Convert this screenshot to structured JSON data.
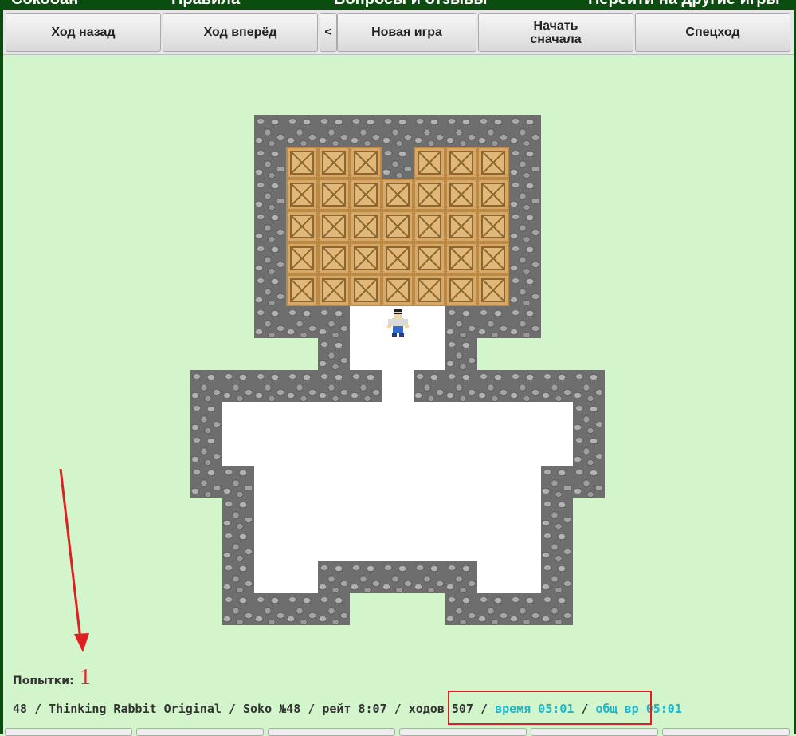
{
  "topnav": [
    "Сокобан",
    "Правила",
    "Вопросы и отзывы",
    "Перейти на другие игры"
  ],
  "toolbar": {
    "undo": "Ход назад",
    "redo": "Ход вперёд",
    "prev": "<",
    "new_game": "Новая игра",
    "restart_line1": "Начать",
    "restart_line2": "сначала",
    "special": "Спецход"
  },
  "board": {
    "walls": [
      [
        8,
        3
      ],
      [
        9,
        3
      ],
      [
        10,
        3
      ],
      [
        11,
        3
      ],
      [
        12,
        3
      ],
      [
        13,
        3
      ],
      [
        14,
        3
      ],
      [
        15,
        3
      ],
      [
        16,
        3
      ],
      [
        8,
        4
      ],
      [
        12,
        4
      ],
      [
        16,
        4
      ],
      [
        8,
        5
      ],
      [
        16,
        5
      ],
      [
        8,
        6
      ],
      [
        16,
        6
      ],
      [
        8,
        7
      ],
      [
        16,
        7
      ],
      [
        8,
        8
      ],
      [
        16,
        8
      ],
      [
        8,
        9
      ],
      [
        9,
        9
      ],
      [
        10,
        9
      ],
      [
        14,
        9
      ],
      [
        15,
        9
      ],
      [
        16,
        9
      ],
      [
        10,
        10
      ],
      [
        14,
        10
      ],
      [
        6,
        11
      ],
      [
        7,
        11
      ],
      [
        8,
        11
      ],
      [
        9,
        11
      ],
      [
        10,
        11
      ],
      [
        11,
        11
      ],
      [
        13,
        11
      ],
      [
        14,
        11
      ],
      [
        15,
        11
      ],
      [
        16,
        11
      ],
      [
        17,
        11
      ],
      [
        18,
        11
      ],
      [
        6,
        12
      ],
      [
        18,
        12
      ],
      [
        6,
        13
      ],
      [
        18,
        13
      ],
      [
        6,
        14
      ],
      [
        7,
        14
      ],
      [
        17,
        14
      ],
      [
        18,
        14
      ],
      [
        7,
        15
      ],
      [
        17,
        15
      ],
      [
        7,
        16
      ],
      [
        17,
        16
      ],
      [
        7,
        17
      ],
      [
        10,
        17
      ],
      [
        11,
        17
      ],
      [
        12,
        17
      ],
      [
        13,
        17
      ],
      [
        14,
        17
      ],
      [
        17,
        17
      ],
      [
        7,
        18
      ],
      [
        8,
        18
      ],
      [
        9,
        18
      ],
      [
        10,
        18
      ],
      [
        14,
        18
      ],
      [
        15,
        18
      ],
      [
        16,
        18
      ],
      [
        17,
        18
      ]
    ],
    "floor": [
      [
        11,
        9
      ],
      [
        12,
        9
      ],
      [
        13,
        9
      ],
      [
        11,
        10
      ],
      [
        12,
        10
      ],
      [
        13,
        10
      ],
      [
        12,
        11
      ],
      [
        7,
        12
      ],
      [
        8,
        12
      ],
      [
        9,
        12
      ],
      [
        10,
        12
      ],
      [
        11,
        12
      ],
      [
        12,
        12
      ],
      [
        13,
        12
      ],
      [
        14,
        12
      ],
      [
        15,
        12
      ],
      [
        16,
        12
      ],
      [
        17,
        12
      ],
      [
        7,
        13
      ],
      [
        8,
        13
      ],
      [
        9,
        13
      ],
      [
        10,
        13
      ],
      [
        11,
        13
      ],
      [
        12,
        13
      ],
      [
        13,
        13
      ],
      [
        14,
        13
      ],
      [
        15,
        13
      ],
      [
        16,
        13
      ],
      [
        17,
        13
      ],
      [
        8,
        14
      ],
      [
        9,
        14
      ],
      [
        10,
        14
      ],
      [
        11,
        14
      ],
      [
        12,
        14
      ],
      [
        13,
        14
      ],
      [
        14,
        14
      ],
      [
        15,
        14
      ],
      [
        16,
        14
      ],
      [
        8,
        15
      ],
      [
        9,
        15
      ],
      [
        10,
        15
      ],
      [
        11,
        15
      ],
      [
        12,
        15
      ],
      [
        13,
        15
      ],
      [
        14,
        15
      ],
      [
        15,
        15
      ],
      [
        16,
        15
      ],
      [
        8,
        16
      ],
      [
        9,
        16
      ],
      [
        10,
        16
      ],
      [
        11,
        16
      ],
      [
        12,
        16
      ],
      [
        13,
        16
      ],
      [
        14,
        16
      ],
      [
        15,
        16
      ],
      [
        16,
        16
      ],
      [
        8,
        17
      ],
      [
        9,
        17
      ],
      [
        15,
        17
      ],
      [
        16,
        17
      ]
    ],
    "boxes": [
      [
        9,
        4
      ],
      [
        10,
        4
      ],
      [
        11,
        4
      ],
      [
        13,
        4
      ],
      [
        14,
        4
      ],
      [
        15,
        4
      ],
      [
        9,
        5
      ],
      [
        10,
        5
      ],
      [
        11,
        5
      ],
      [
        12,
        5
      ],
      [
        13,
        5
      ],
      [
        14,
        5
      ],
      [
        15,
        5
      ],
      [
        9,
        6
      ],
      [
        10,
        6
      ],
      [
        11,
        6
      ],
      [
        12,
        6
      ],
      [
        13,
        6
      ],
      [
        14,
        6
      ],
      [
        15,
        6
      ],
      [
        9,
        7
      ],
      [
        10,
        7
      ],
      [
        11,
        7
      ],
      [
        12,
        7
      ],
      [
        13,
        7
      ],
      [
        14,
        7
      ],
      [
        15,
        7
      ],
      [
        9,
        8
      ],
      [
        10,
        8
      ],
      [
        11,
        8
      ],
      [
        12,
        8
      ],
      [
        13,
        8
      ],
      [
        14,
        8
      ],
      [
        15,
        8
      ]
    ],
    "player": [
      12,
      9
    ]
  },
  "attempts": {
    "label": "Попытки:",
    "value": "1"
  },
  "status": {
    "main": "48 / Thinking Rabbit Original / Soko №48 / рейт 8:07 / ходов 507 / ",
    "time": "время 05:01",
    "sep": " / ",
    "total_time": "общ вр 05:01"
  },
  "colors": {
    "background": "#d3f5cb",
    "nav": "#0b4d0e",
    "annotation": "#e02020",
    "time_text": "#1fb6c9"
  }
}
